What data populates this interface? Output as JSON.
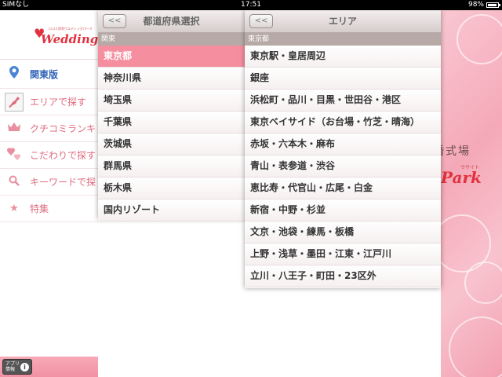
{
  "status_bar": {
    "carrier": "SIMなし",
    "time": "17:51",
    "battery": "98%"
  },
  "app": {
    "logo_tagline": "口コミ評判ウエディングパーク",
    "logo_text": "Wedding Pa",
    "menu": [
      {
        "label": "関東版",
        "icon": "location-pin-icon",
        "active": true
      },
      {
        "label": "エリアで探す",
        "icon": "japan-map-icon",
        "active": false
      },
      {
        "label": "クチコミランキ",
        "icon": "crown-icon",
        "active": false
      },
      {
        "label": "こだわりで探す",
        "icon": "hearts-icon",
        "active": false
      },
      {
        "label": "キーワードで探",
        "icon": "magnifier-icon",
        "active": false
      },
      {
        "label": "特集",
        "icon": "star-icon",
        "active": false
      }
    ],
    "footer": {
      "app_info_label_1": "アプリ",
      "app_info_label_2": "情報",
      "info_glyph": "i"
    }
  },
  "background": {
    "hall_text": "婚式場",
    "site_text": "ウサイト",
    "park_text": "Park"
  },
  "prefecture_panel": {
    "title": "都道府県選択",
    "back_label": "<<",
    "section": "関東",
    "items": [
      "東京都",
      "神奈川県",
      "埼玉県",
      "千葉県",
      "茨城県",
      "群馬県",
      "栃木県",
      "国内リゾート"
    ],
    "selected_index": 0
  },
  "area_panel": {
    "title": "エリア",
    "back_label": "<<",
    "section": "東京都",
    "items": [
      "東京駅・皇居周辺",
      "銀座",
      "浜松町・品川・目黒・世田谷・港区",
      "東京ベイサイド（お台場・竹芝・晴海）",
      "赤坂・六本木・麻布",
      "青山・表参道・渋谷",
      "恵比寿・代官山・広尾・白金",
      "新宿・中野・杉並",
      "文京・池袋・練馬・板橋",
      "上野・浅草・墨田・江東・江戸川",
      "立川・八王子・町田・23区外"
    ]
  },
  "colors": {
    "accent_pink": "#f58f9f",
    "logo_red": "#e0323f",
    "active_blue": "#2f62b8"
  }
}
